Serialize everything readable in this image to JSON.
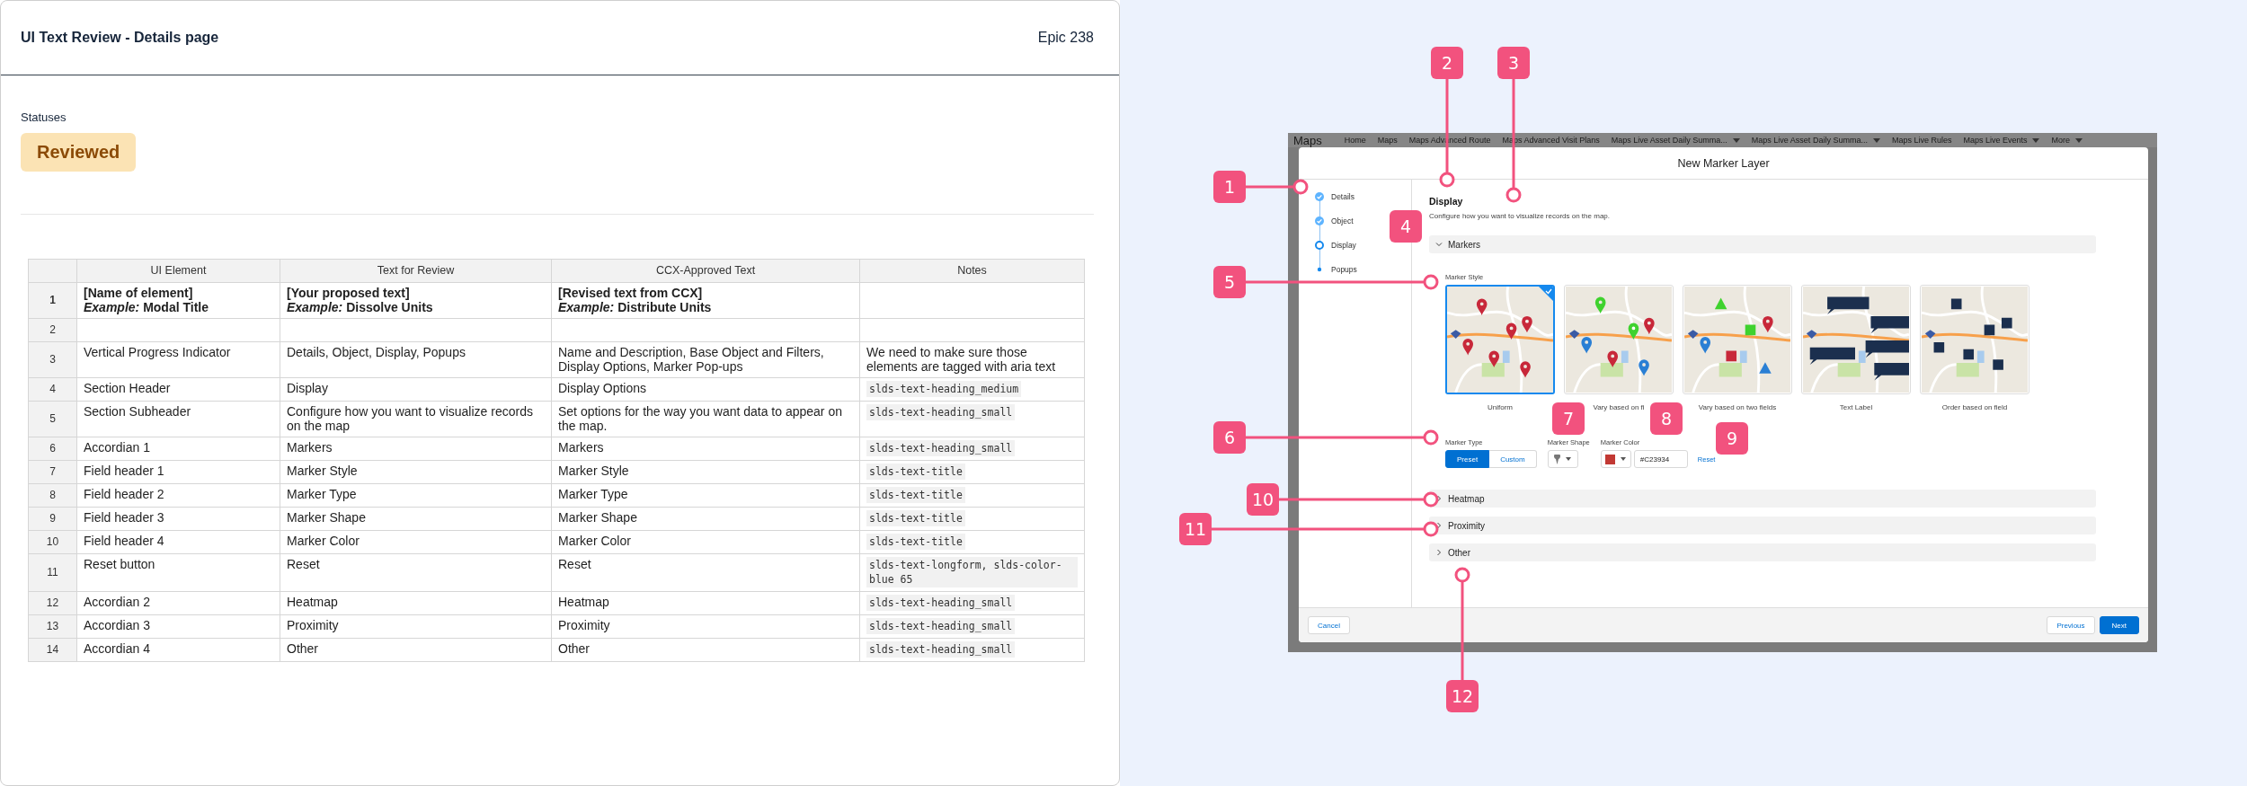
{
  "header": {
    "title": "UI Text Review - Details page",
    "epic": "Epic 238"
  },
  "statuses": {
    "label": "Statuses",
    "badge": "Reviewed"
  },
  "table": {
    "columns": [
      "UI Element",
      "Text for Review",
      "CCX-Approved Text",
      "Notes"
    ],
    "rows": [
      {
        "index": "1",
        "kind": "template",
        "cells": [
          "[Name of element]\n*Example:* Modal Title",
          "[Your proposed text]\n*Example:* Dissolve Units",
          "[Revised text from CCX]\n*Example:* Distribute Units"
        ]
      },
      {
        "index": "2",
        "kind": "entry"
      },
      {
        "index": "3",
        "kind": "entry",
        "cells": [
          "Vertical Progress Indicator",
          "Details, Object, Display, Popups",
          "Name and Description, Base Object and Filters, Display Options, Marker Pop-ups"
        ],
        "note": {
          "kind": "text",
          "text": "We need to make sure those elements are tagged with aria text"
        }
      },
      {
        "index": "4",
        "kind": "entry",
        "cells": [
          "Section Header",
          "Display",
          "Display Options"
        ],
        "note": {
          "kind": "code",
          "text": "slds-text-heading_medium"
        }
      },
      {
        "index": "5",
        "kind": "entry",
        "cells": [
          "Section Subheader",
          "Configure how you want to visualize records on the map",
          "Set options for the way you want data to appear on the map."
        ],
        "note": {
          "kind": "code",
          "text": "slds-text-heading_small"
        }
      },
      {
        "index": "6",
        "kind": "entry",
        "cells": [
          "Accordian 1",
          "Markers",
          "Markers"
        ],
        "note": {
          "kind": "code",
          "text": "slds-text-heading_small"
        }
      },
      {
        "index": "7",
        "kind": "entry",
        "cells": [
          "Field header 1",
          "Marker Style",
          "Marker Style"
        ],
        "note": {
          "kind": "code",
          "text": "slds-text-title"
        }
      },
      {
        "index": "8",
        "kind": "entry",
        "cells": [
          "Field header 2",
          "Marker Type",
          "Marker Type"
        ],
        "note": {
          "kind": "code",
          "text": "slds-text-title"
        }
      },
      {
        "index": "9",
        "kind": "entry",
        "cells": [
          "Field header 3",
          "Marker Shape",
          "Marker Shape"
        ],
        "note": {
          "kind": "code",
          "text": "slds-text-title"
        }
      },
      {
        "index": "10",
        "kind": "entry",
        "cells": [
          "Field header 4",
          "Marker Color",
          "Marker Color"
        ],
        "note": {
          "kind": "code",
          "text": "slds-text-title"
        }
      },
      {
        "index": "11",
        "kind": "entry",
        "cells": [
          "Reset button",
          "Reset",
          "Reset"
        ],
        "note": {
          "kind": "code",
          "text": "slds-text-longform, slds-color-blue 65"
        }
      },
      {
        "index": "12",
        "kind": "entry",
        "cells": [
          "Accordian 2",
          "Heatmap",
          "Heatmap"
        ],
        "note": {
          "kind": "code",
          "text": "slds-text-heading_small"
        }
      },
      {
        "index": "13",
        "kind": "entry",
        "cells": [
          "Accordian 3",
          "Proximity",
          "Proximity"
        ],
        "note": {
          "kind": "code",
          "text": "slds-text-heading_small"
        }
      },
      {
        "index": "14",
        "kind": "entry",
        "cells": [
          "Accordian 4",
          "Other",
          "Other"
        ],
        "note": {
          "kind": "code",
          "text": "slds-text-heading_small"
        }
      }
    ]
  },
  "screenshot": {
    "nav": {
      "app": "Maps",
      "tabs": [
        {
          "label": "Home",
          "dropdown": false
        },
        {
          "label": "Maps",
          "dropdown": false
        },
        {
          "label": "Maps Advanced Route",
          "dropdown": false
        },
        {
          "label": "Maps Advanced Visit Plans",
          "dropdown": false
        },
        {
          "label": "Maps Live Asset Daily Summa...",
          "dropdown": true
        },
        {
          "label": "Maps Live Asset Daily Summa...",
          "dropdown": true
        },
        {
          "label": "Maps Live Rules",
          "dropdown": false
        },
        {
          "label": "Maps Live Events",
          "dropdown": true
        },
        {
          "label": "More",
          "dropdown": true
        }
      ]
    },
    "modal": {
      "title": "New Marker Layer",
      "steps": [
        {
          "label": "Details",
          "completed": true,
          "current": false
        },
        {
          "label": "Object",
          "completed": true,
          "current": false
        },
        {
          "label": "Display",
          "completed": false,
          "current": true
        },
        {
          "label": "Popups",
          "completed": false,
          "current": false
        }
      ],
      "section_title": "Display",
      "section_subtitle": "Configure how you want to visualize records on the map.",
      "markers": {
        "label": "Markers",
        "expanded": true
      },
      "marker_style": {
        "label": "Marker Style",
        "styles": [
          {
            "label": "Uniform",
            "selected": true
          },
          {
            "label": "Vary based on fi",
            "selected": false
          },
          {
            "label": "Vary based on two fields",
            "selected": false
          },
          {
            "label": "Text Label",
            "selected": false
          },
          {
            "label": "Order based on field",
            "selected": false
          }
        ]
      },
      "marker_type": {
        "label": "Marker Type",
        "options": [
          {
            "label": "Preset",
            "selected": true
          },
          {
            "label": "Custom",
            "selected": false
          }
        ]
      },
      "marker_shape": {
        "label": "Marker Shape"
      },
      "marker_color": {
        "label": "Marker Color",
        "value": "#C23934"
      },
      "reset": "Reset",
      "accordions": [
        {
          "label": "Heatmap",
          "expanded": false
        },
        {
          "label": "Proximity",
          "expanded": false
        },
        {
          "label": "Other",
          "expanded": false
        }
      ],
      "footer": {
        "cancel": "Cancel",
        "previous": "Previous",
        "next": "Next"
      }
    }
  },
  "callouts": [
    {
      "number": "1"
    },
    {
      "number": "2"
    },
    {
      "number": "3"
    },
    {
      "number": "4"
    },
    {
      "number": "5"
    },
    {
      "number": "6"
    },
    {
      "number": "7"
    },
    {
      "number": "8"
    },
    {
      "number": "9"
    },
    {
      "number": "10"
    },
    {
      "number": "11"
    },
    {
      "number": "12"
    }
  ]
}
